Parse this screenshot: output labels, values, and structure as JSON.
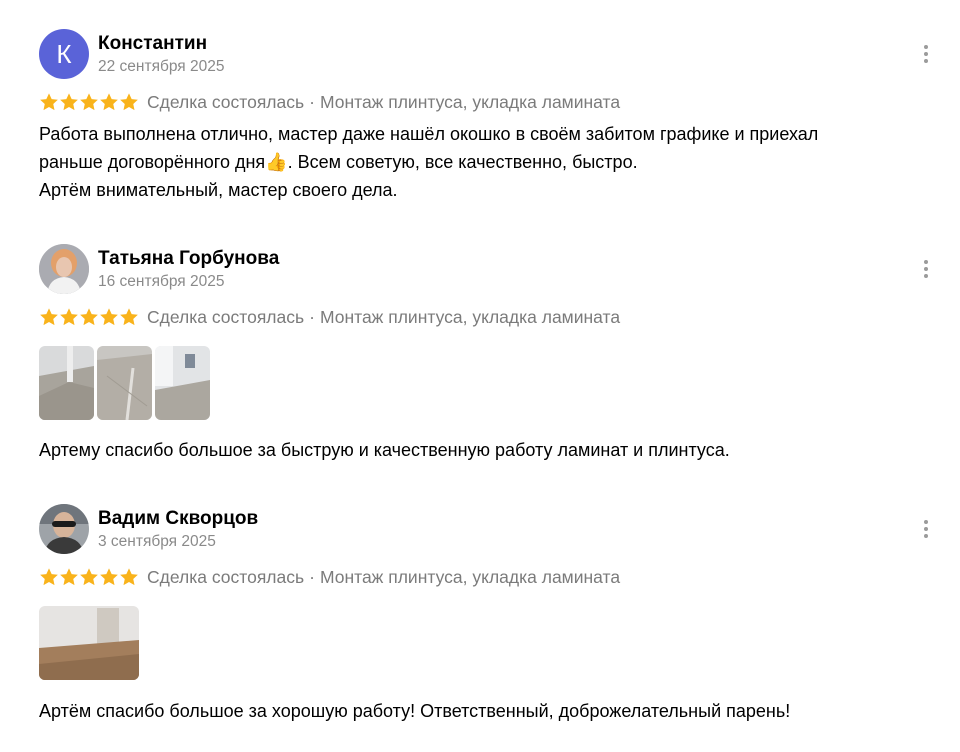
{
  "reviews": [
    {
      "author": "Константин",
      "avatar_letter": "К",
      "avatar_color": "#5a63d8",
      "date": "22 сентября 2025",
      "rating": 5,
      "deal": "Сделка состоялась",
      "separator": "·",
      "service": "Монтаж плинтуса, укладка ламината",
      "text_part1": "Работа выполнена отлично, мастер даже нашёл окошко в своём забитом графике и приехал\nраньше договорённого дня",
      "emoji": "👍",
      "text_part2": ". Всем советую, все качественно, быстро.\nАртём внимательный, мастер своего дела.",
      "photos": []
    },
    {
      "author": "Татьяна Горбунова",
      "date": "16 сентября 2025",
      "rating": 5,
      "deal": "Сделка состоялась",
      "separator": "·",
      "service": "Монтаж плинтуса, укладка ламината",
      "text": "Артему спасибо большое за быструю и качественную работу ламинат и плинтуса.",
      "photos": 3
    },
    {
      "author": "Вадим Скворцов",
      "date": "3 сентября 2025",
      "rating": 5,
      "deal": "Сделка состоялась",
      "separator": "·",
      "service": "Монтаж плинтуса, укладка ламината",
      "text": "Артём спасибо большое за хорошую работу! Ответственный, доброжелательный парень!",
      "photos": 1
    }
  ],
  "colors": {
    "star": "#f9b31b",
    "meta": "#7b7b7b",
    "date": "#8a8a8a"
  },
  "icons": {
    "star": "star-icon",
    "menu": "more-vertical-icon"
  }
}
